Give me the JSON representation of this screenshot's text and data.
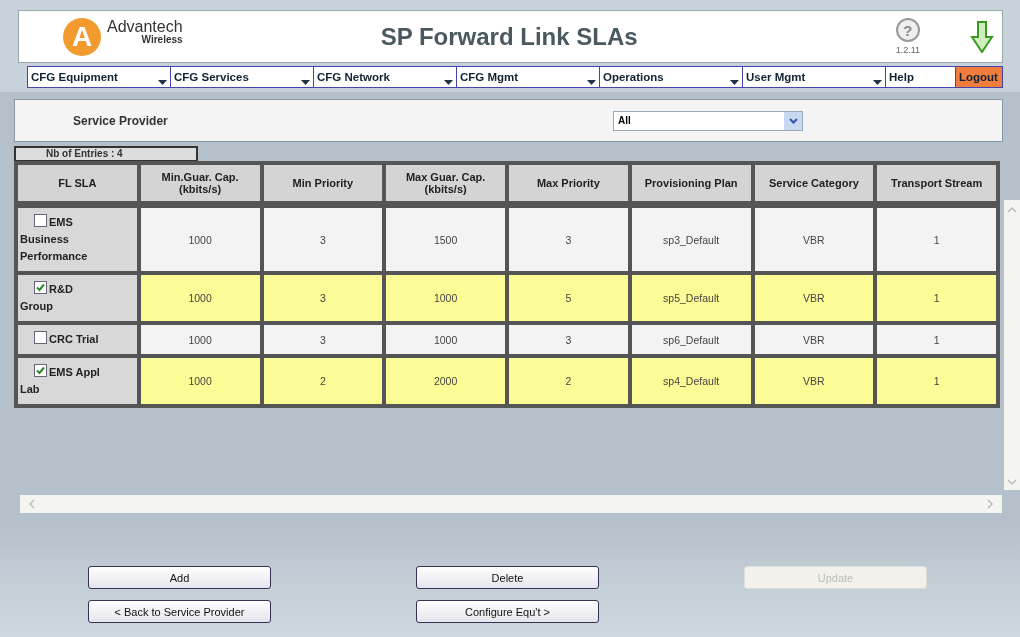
{
  "header": {
    "brand": "Advantech",
    "brand_sub": "Wireless",
    "logo_letter": "A",
    "title": "SP Forward Link SLAs",
    "help": "?",
    "version": "1.2.11"
  },
  "menu": [
    {
      "label": "CFG Equipment",
      "kind": "dropdown"
    },
    {
      "label": "CFG Services",
      "kind": "dropdown"
    },
    {
      "label": "CFG Network",
      "kind": "dropdown"
    },
    {
      "label": "CFG Mgmt",
      "kind": "dropdown"
    },
    {
      "label": "Operations",
      "kind": "dropdown"
    },
    {
      "label": "User Mgmt",
      "kind": "dropdown"
    },
    {
      "label": "Help",
      "kind": "link"
    },
    {
      "label": "Logout",
      "kind": "logout"
    }
  ],
  "filter": {
    "label": "Service Provider",
    "value": "All"
  },
  "entries": "Nb of Entries : 4",
  "table": {
    "columns": [
      "FL SLA",
      "Min.Guar. Cap. (kbits/s)",
      "Min Priority",
      "Max Guar. Cap. (kbits/s)",
      "Max Priority",
      "Provisioning Plan",
      "Service Category",
      "Transport Stream"
    ],
    "rows": [
      {
        "checked": false,
        "cells": [
          "EMS Business Performance",
          "1000",
          "3",
          "1500",
          "3",
          "sp3_Default",
          "VBR",
          "1"
        ]
      },
      {
        "checked": true,
        "cells": [
          "R&D Group",
          "1000",
          "3",
          "1000",
          "5",
          "sp5_Default",
          "VBR",
          "1"
        ]
      },
      {
        "checked": false,
        "cells": [
          "CRC Trial",
          "1000",
          "3",
          "1000",
          "3",
          "sp6_Default",
          "VBR",
          "1"
        ]
      },
      {
        "checked": true,
        "cells": [
          "EMS Appl Lab",
          "1000",
          "2",
          "2000",
          "2",
          "sp4_Default",
          "VBR",
          "1"
        ]
      }
    ]
  },
  "buttons": [
    {
      "label": "Add",
      "disabled": false
    },
    {
      "label": "Delete",
      "disabled": false
    },
    {
      "label": "Update",
      "disabled": true
    },
    {
      "label": "< Back to Service Provider",
      "disabled": false
    },
    {
      "label": "Configure Equ't >",
      "disabled": false
    }
  ]
}
